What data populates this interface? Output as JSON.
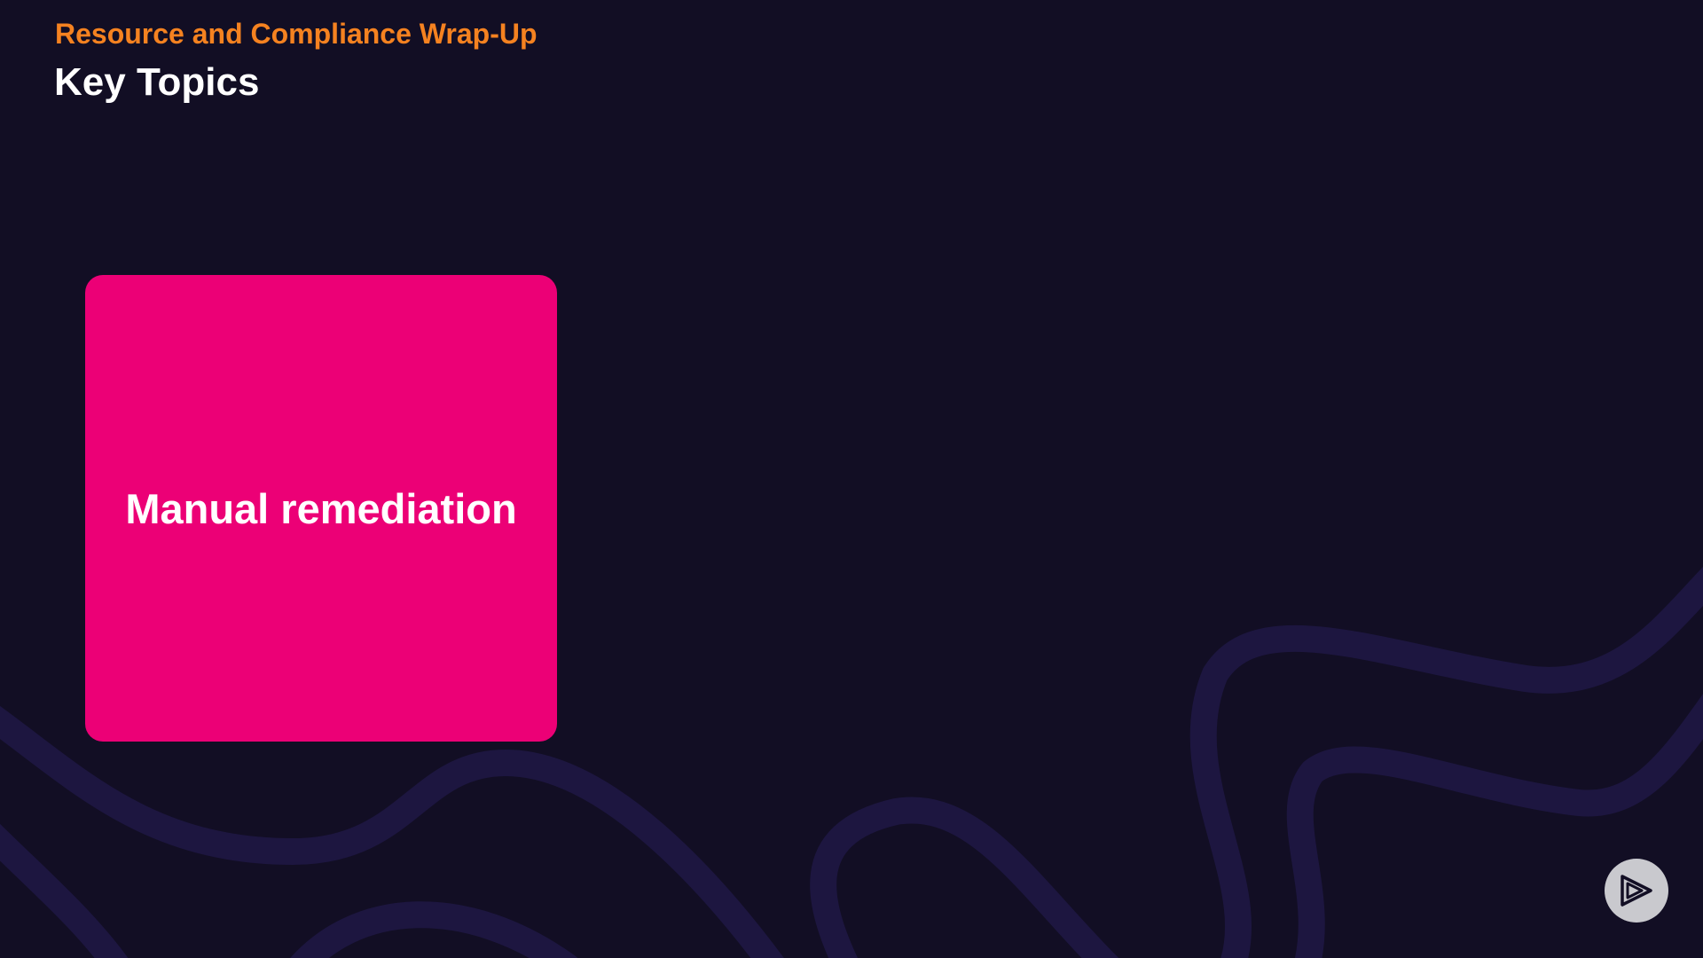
{
  "header": {
    "subtitle": "Resource and Compliance Wrap-Up",
    "title": "Key Topics"
  },
  "cards": [
    {
      "label": "Manual remediation",
      "color": "#ec0076"
    }
  ],
  "colors": {
    "background": "#120e24",
    "accent": "#f58220",
    "swirl": "#1d1640",
    "logo_bg": "#c9c9ce"
  },
  "icons": {
    "logo": "play-logo-icon"
  }
}
